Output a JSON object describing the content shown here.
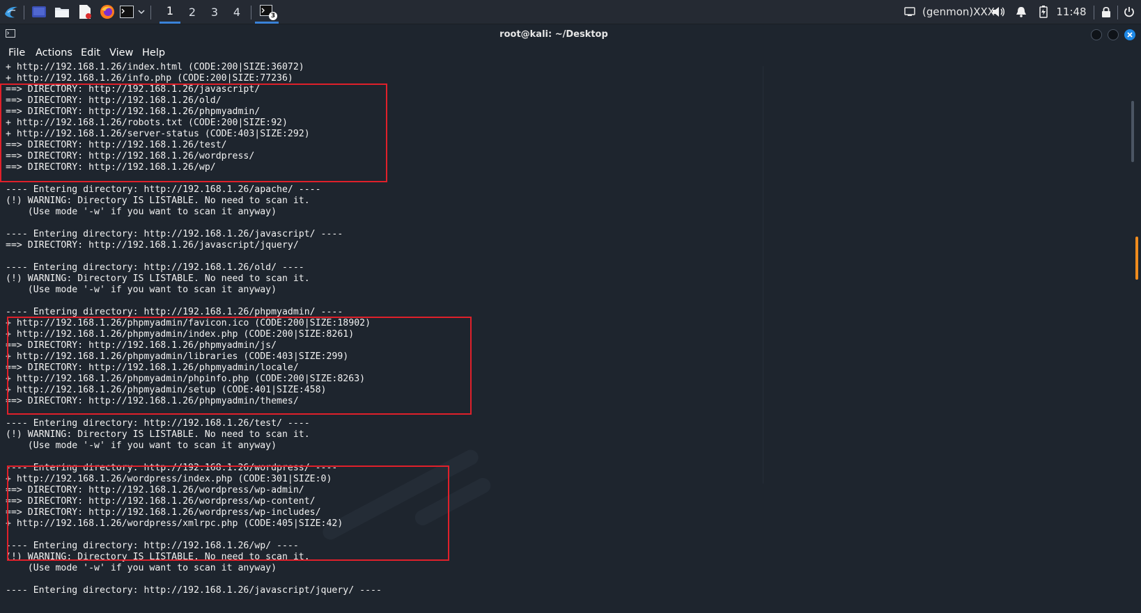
{
  "taskbar": {
    "workspaces": [
      "1",
      "2",
      "3",
      "4"
    ],
    "active_workspace": "1",
    "genmon": "(genmon)XXX",
    "clock": "11:48",
    "badge": "3",
    "apps": [
      {
        "name": "kali-menu-icon"
      },
      {
        "name": "desktop-icon"
      },
      {
        "name": "file-manager-icon"
      },
      {
        "name": "text-editor-icon"
      },
      {
        "name": "firefox-icon"
      },
      {
        "name": "terminal-icon"
      }
    ]
  },
  "window": {
    "title": "root@kali: ~/Desktop",
    "menu": [
      "File",
      "Actions",
      "Edit",
      "View",
      "Help"
    ]
  },
  "terminal": {
    "lines": [
      "+ http://192.168.1.26/index.html (CODE:200|SIZE:36072)",
      "+ http://192.168.1.26/info.php (CODE:200|SIZE:77236)",
      "==> DIRECTORY: http://192.168.1.26/javascript/",
      "==> DIRECTORY: http://192.168.1.26/old/",
      "==> DIRECTORY: http://192.168.1.26/phpmyadmin/",
      "+ http://192.168.1.26/robots.txt (CODE:200|SIZE:92)",
      "+ http://192.168.1.26/server-status (CODE:403|SIZE:292)",
      "==> DIRECTORY: http://192.168.1.26/test/",
      "==> DIRECTORY: http://192.168.1.26/wordpress/",
      "==> DIRECTORY: http://192.168.1.26/wp/",
      "",
      "---- Entering directory: http://192.168.1.26/apache/ ----",
      "(!) WARNING: Directory IS LISTABLE. No need to scan it.",
      "    (Use mode '-w' if you want to scan it anyway)",
      "",
      "---- Entering directory: http://192.168.1.26/javascript/ ----",
      "==> DIRECTORY: http://192.168.1.26/javascript/jquery/",
      "",
      "---- Entering directory: http://192.168.1.26/old/ ----",
      "(!) WARNING: Directory IS LISTABLE. No need to scan it.",
      "    (Use mode '-w' if you want to scan it anyway)",
      "",
      "---- Entering directory: http://192.168.1.26/phpmyadmin/ ----",
      "+ http://192.168.1.26/phpmyadmin/favicon.ico (CODE:200|SIZE:18902)",
      "+ http://192.168.1.26/phpmyadmin/index.php (CODE:200|SIZE:8261)",
      "==> DIRECTORY: http://192.168.1.26/phpmyadmin/js/",
      "+ http://192.168.1.26/phpmyadmin/libraries (CODE:403|SIZE:299)",
      "==> DIRECTORY: http://192.168.1.26/phpmyadmin/locale/",
      "+ http://192.168.1.26/phpmyadmin/phpinfo.php (CODE:200|SIZE:8263)",
      "+ http://192.168.1.26/phpmyadmin/setup (CODE:401|SIZE:458)",
      "==> DIRECTORY: http://192.168.1.26/phpmyadmin/themes/",
      "",
      "---- Entering directory: http://192.168.1.26/test/ ----",
      "(!) WARNING: Directory IS LISTABLE. No need to scan it.",
      "    (Use mode '-w' if you want to scan it anyway)",
      "",
      "---- Entering directory: http://192.168.1.26/wordpress/ ----",
      "+ http://192.168.1.26/wordpress/index.php (CODE:301|SIZE:0)",
      "==> DIRECTORY: http://192.168.1.26/wordpress/wp-admin/",
      "==> DIRECTORY: http://192.168.1.26/wordpress/wp-content/",
      "==> DIRECTORY: http://192.168.1.26/wordpress/wp-includes/",
      "+ http://192.168.1.26/wordpress/xmlrpc.php (CODE:405|SIZE:42)",
      "",
      "---- Entering directory: http://192.168.1.26/wp/ ----",
      "(!) WARNING: Directory IS LISTABLE. No need to scan it.",
      "    (Use mode '-w' if you want to scan it anyway)",
      "",
      "---- Entering directory: http://192.168.1.26/javascript/jquery/ ----"
    ],
    "bold_line_index": 48
  },
  "colors": {
    "taskbar_bg": "#252a33",
    "terminal_bg": "#1e252e",
    "text": "#f2f2f2",
    "highlight_box": "#e0202a",
    "active_workspace": "#3a82d8",
    "scroll_thumb_accent": "#f08c1e",
    "close_button": "#1e88e5"
  }
}
